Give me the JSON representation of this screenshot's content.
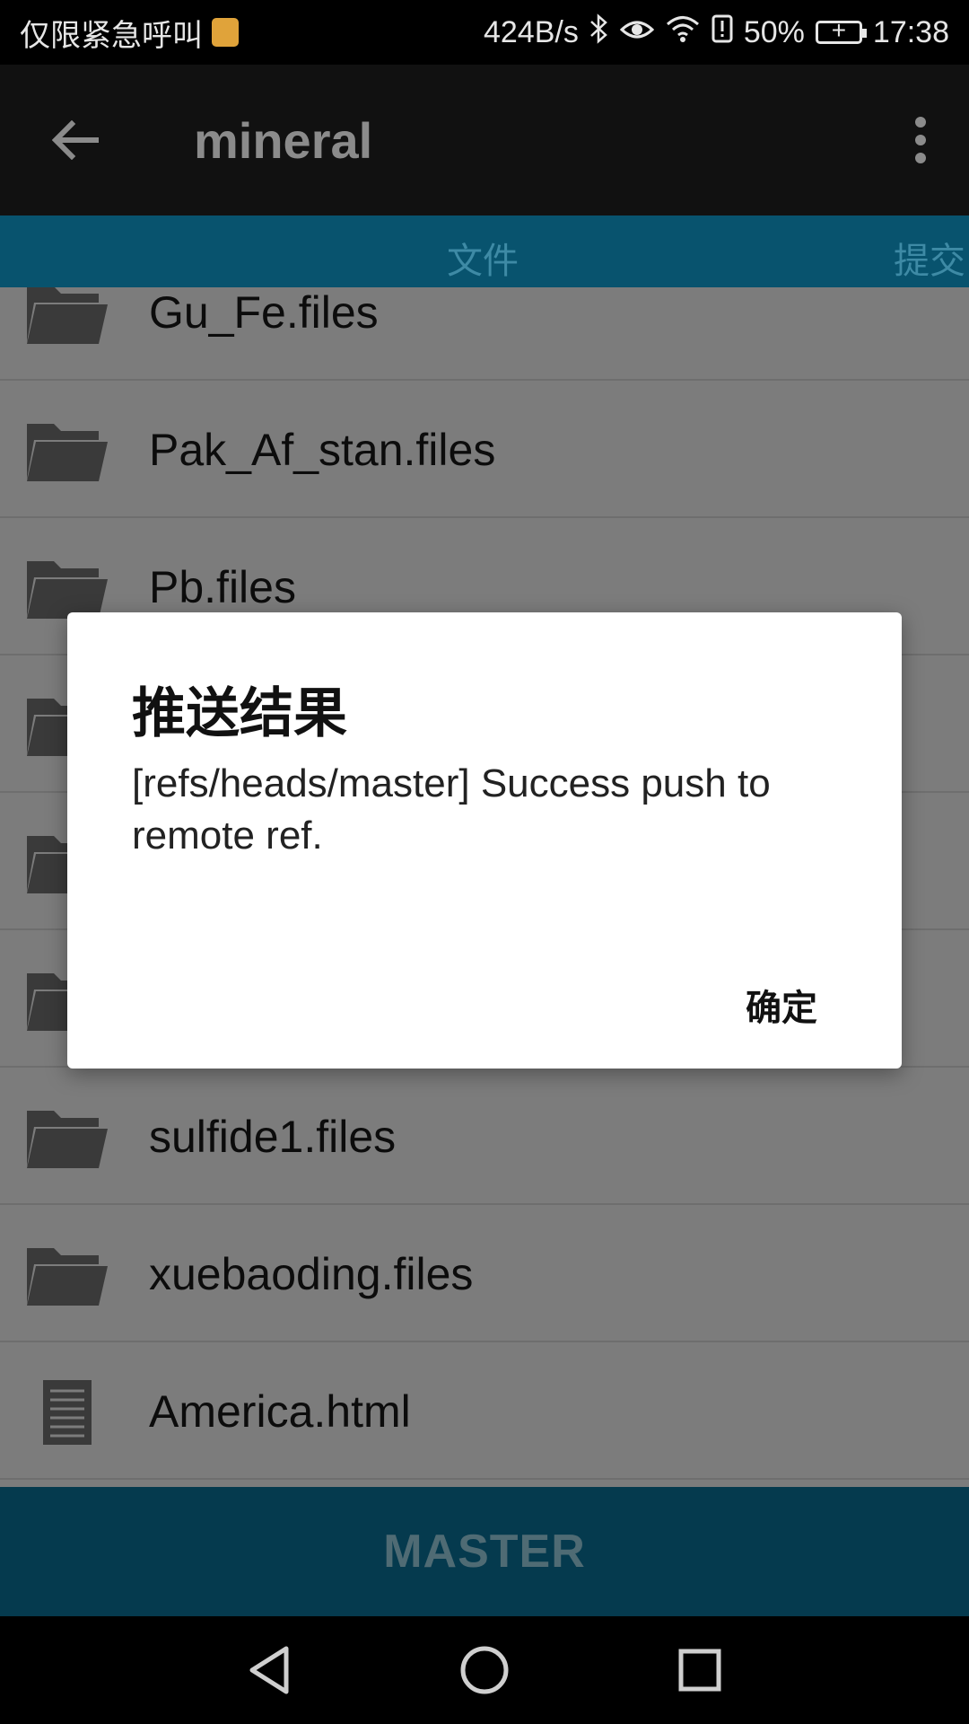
{
  "status_bar": {
    "carrier_text": "仅限紧急呼叫",
    "network_speed": "424B/s",
    "battery_percent": "50%",
    "time": "17:38",
    "icons": [
      "sim-icon",
      "bluetooth-icon",
      "eye-comfort-icon",
      "wifi-icon",
      "alert-icon",
      "battery-charging-icon"
    ]
  },
  "app_bar": {
    "title": "mineral",
    "back_icon": "arrow-back-icon",
    "overflow_icon": "more-vert-icon"
  },
  "tabs": [
    {
      "label": "文件",
      "active": true
    },
    {
      "label": "提交",
      "active": false
    }
  ],
  "files": [
    {
      "name": "Gu_Fe.files",
      "type": "folder"
    },
    {
      "name": "Pak_Af_stan.files",
      "type": "folder"
    },
    {
      "name": "Pb.files",
      "type": "folder"
    },
    {
      "name": "",
      "type": "folder"
    },
    {
      "name": "",
      "type": "folder"
    },
    {
      "name": "",
      "type": "folder"
    },
    {
      "name": "sulfide1.files",
      "type": "folder"
    },
    {
      "name": "xuebaoding.files",
      "type": "folder"
    },
    {
      "name": "America.html",
      "type": "file"
    }
  ],
  "branch_bar": {
    "label": "MASTER"
  },
  "dialog": {
    "title": "推送结果",
    "message": "[refs/heads/master] Success push to remote ref.",
    "ok_label": "确定"
  },
  "nav_bar": {
    "icons": [
      "back-triangle-icon",
      "home-circle-icon",
      "recents-square-icon"
    ]
  },
  "colors": {
    "tab_bar": "#08536e",
    "branch_bar": "#053a4e",
    "list_dimmed": "#7c7c7c",
    "dialog_bg": "#ffffff"
  }
}
